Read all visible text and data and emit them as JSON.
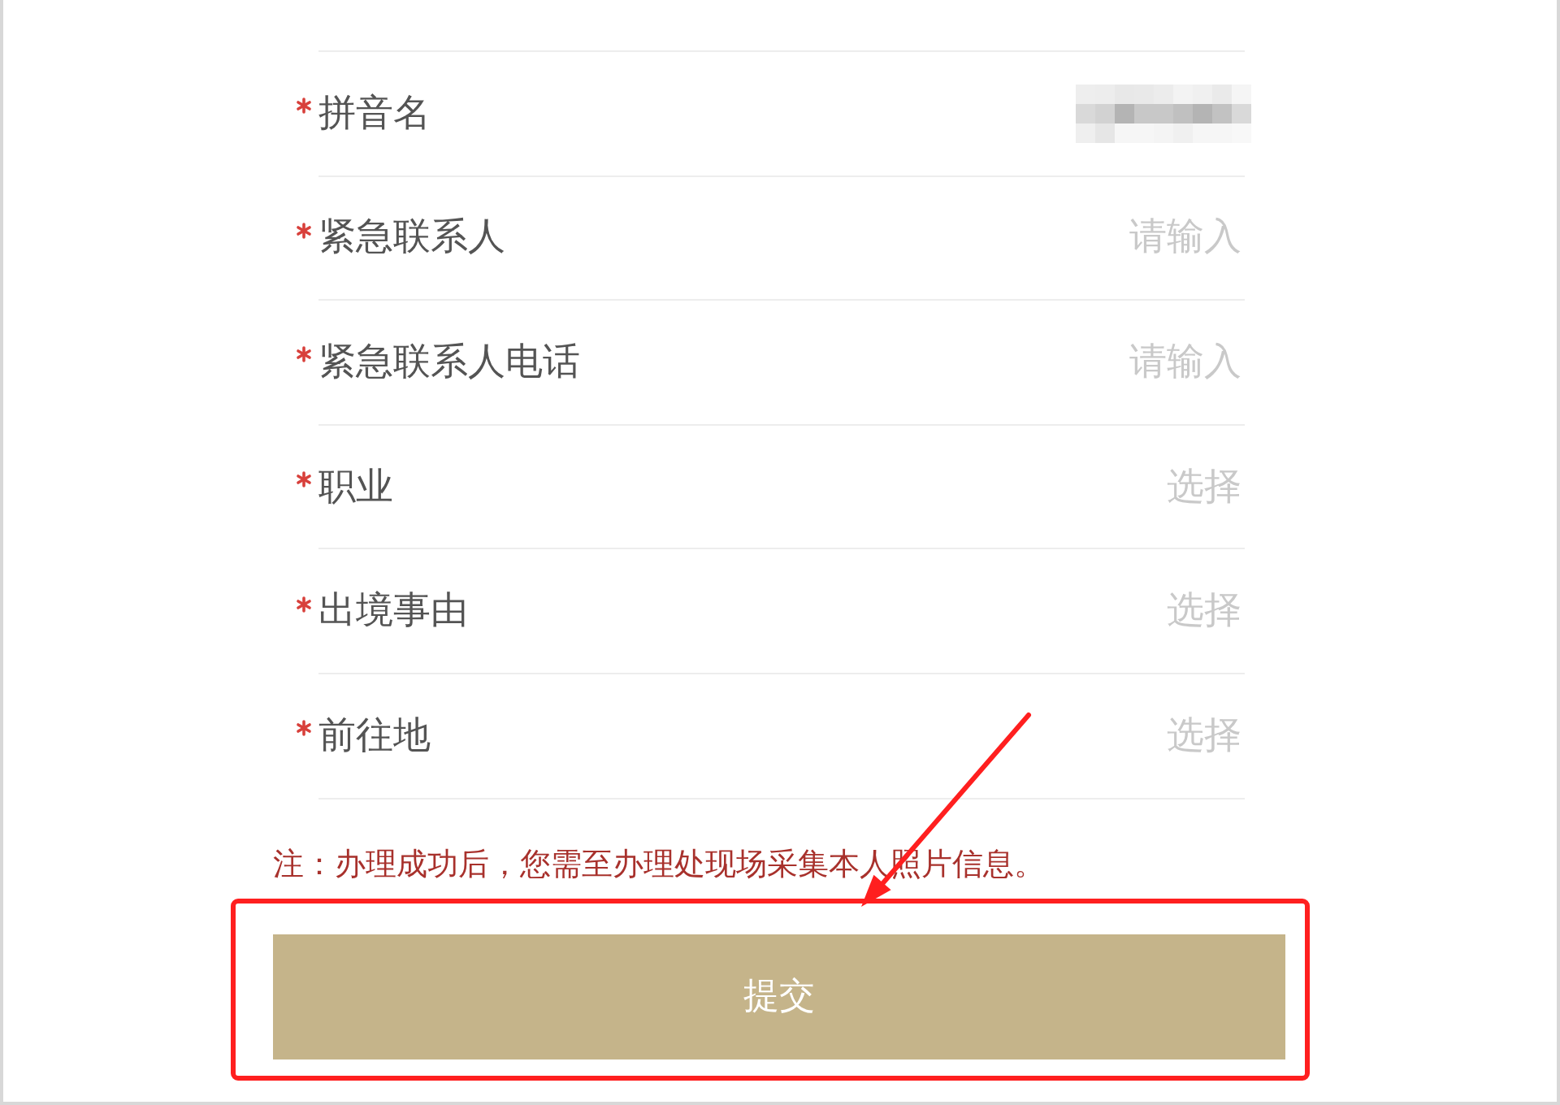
{
  "form": {
    "rows": [
      {
        "label": "拼音名",
        "required": true,
        "kind": "redacted"
      },
      {
        "label": "紧急联系人",
        "required": true,
        "kind": "input",
        "placeholder": "请输入"
      },
      {
        "label": "紧急联系人电话",
        "required": true,
        "kind": "input",
        "placeholder": "请输入"
      },
      {
        "label": "职业",
        "required": true,
        "kind": "select",
        "placeholder": "选择"
      },
      {
        "label": "出境事由",
        "required": true,
        "kind": "select",
        "placeholder": "选择"
      },
      {
        "label": "前往地",
        "required": true,
        "kind": "select",
        "placeholder": "选择"
      }
    ]
  },
  "note": "注：办理成功后，您需至办理处现场采集本人照片信息。",
  "submit_button": {
    "label": "提交"
  },
  "annotations": {
    "highlight_frame": true,
    "arrow": true
  }
}
